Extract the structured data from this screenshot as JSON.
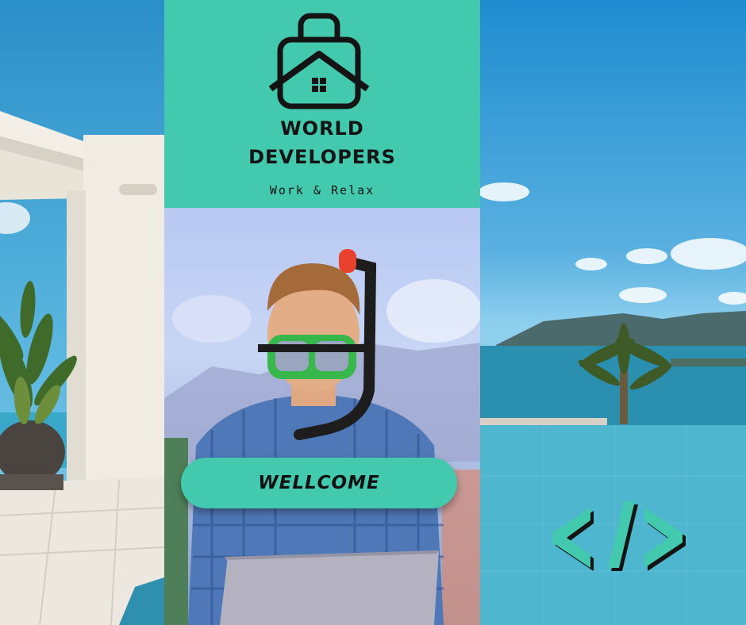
{
  "brand": {
    "title_line1": "WORLD",
    "title_line2": "DEVELOPERS",
    "tagline": "Work & Relax"
  },
  "cta": {
    "welcome_label": "WELLCOME"
  },
  "icons": {
    "logo": "house-in-suitcase-icon",
    "code": "code-brackets-icon"
  },
  "colors": {
    "accent": "#43c9ad",
    "text": "#141414"
  }
}
